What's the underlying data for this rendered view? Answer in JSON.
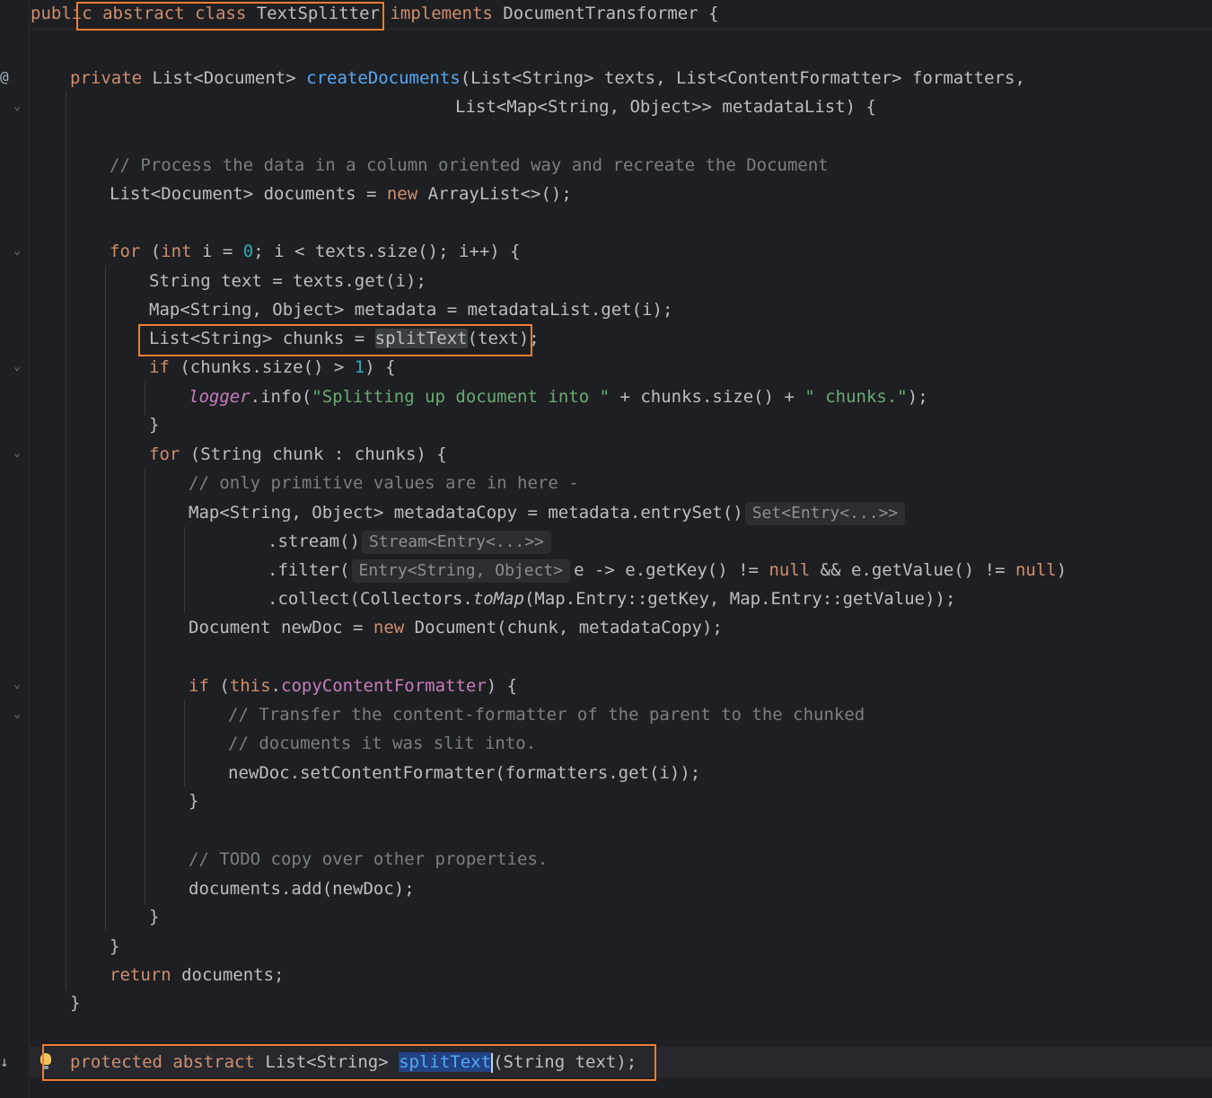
{
  "editor": {
    "language": "java",
    "class_name": "TextSplitter",
    "lines": {
      "l01": {
        "t1": "public",
        "t2": "abstract",
        "t3": "class",
        "t4": "TextSplitter",
        "t5": "implements",
        "t6": "DocumentTransformer {"
      },
      "l02": {
        "t1": "private",
        "t2": "List<Document>",
        "t3": "createDocuments",
        "t4": "(List<String> texts, List<ContentFormatter> formatters,"
      },
      "l03": {
        "t1": "List<Map<String, Object>> metadataList) {"
      },
      "l04": {
        "t1": "// Process the data in a column oriented way and recreate the Document"
      },
      "l05": {
        "t1": "List<Document> documents = ",
        "t2": "new",
        "t3": " ArrayList<>();"
      },
      "l06": {
        "t1": "for",
        "t2": " (",
        "t3": "int",
        "t4": " i = ",
        "t5": "0",
        "t6": "; i < texts.size(); i++) {"
      },
      "l07": {
        "t1": "String text = texts.get(i);"
      },
      "l08": {
        "t1": "Map<String, Object> metadata = metadataList.get(i);"
      },
      "l09": {
        "t1": "List<String> chunks = ",
        "t2": "splitText",
        "t3": "(text);"
      },
      "l10": {
        "t1": "if",
        "t2": " (chunks.size() > ",
        "t3": "1",
        "t4": ") {"
      },
      "l11": {
        "t1": "logger",
        "t2": ".info(",
        "t3": "\"Splitting up document into \"",
        "t4": " + chunks.size() + ",
        "t5": "\" chunks.\"",
        "t6": ");"
      },
      "l12": {
        "t1": "}"
      },
      "l13": {
        "t1": "for",
        "t2": " (String chunk : chunks) {"
      },
      "l14": {
        "t1": "// only primitive values are in here -"
      },
      "l15": {
        "t1": "Map<String, Object> metadataCopy = metadata.entrySet()",
        "hint": "Set<Entry<...>>"
      },
      "l16": {
        "t1": ".stream()",
        "hint": "Stream<Entry<...>>"
      },
      "l17": {
        "t1": ".filter(",
        "hint": "Entry<String, Object>",
        "t2": "e -> e.getKey() != ",
        "t3": "null",
        "t4": " && e.getValue() != ",
        "t5": "null",
        "t6": ")"
      },
      "l18": {
        "t1": ".collect(Collectors.",
        "t2": "toMap",
        "t3": "(Map.Entry::getKey, Map.Entry::getValue));"
      },
      "l19": {
        "t1": "Document newDoc = ",
        "t2": "new",
        "t3": " Document(chunk, metadataCopy);"
      },
      "l20": {
        "t1": "if",
        "t2": " (",
        "t3": "this",
        "t4": ".",
        "t5": "copyContentFormatter",
        "t6": ") {"
      },
      "l21": {
        "t1": "// Transfer the content-formatter of the parent to the chunked"
      },
      "l22": {
        "t1": "// documents it was slit into."
      },
      "l23": {
        "t1": "newDoc.setContentFormatter(formatters.get(i));"
      },
      "l24": {
        "t1": "}"
      },
      "l25": {
        "t1": "// TODO copy over other properties."
      },
      "l26": {
        "t1": "documents.add(newDoc);"
      },
      "l27": {
        "t1": "}"
      },
      "l28": {
        "t1": "}"
      },
      "l29": {
        "t1": "return",
        "t2": " documents;"
      },
      "l30": {
        "t1": "}"
      },
      "l31": {
        "t1": "protected",
        "t2": "abstract",
        "t3": "List<String>",
        "t4": "splitText",
        "t5": "(String text);"
      }
    }
  },
  "gutter_icons": {
    "annotation_icon": "@",
    "implementation_icon": "↓",
    "intention_bulb": "lightbulb-icon"
  },
  "colors": {
    "background": "#1e1f22",
    "keyword": "#cf8e6d",
    "method": "#56a8f5",
    "comment": "#7a7e85",
    "string": "#6aab73",
    "number": "#2aacb8",
    "field": "#c77dbb",
    "highlight_box": "#ee7d31"
  }
}
